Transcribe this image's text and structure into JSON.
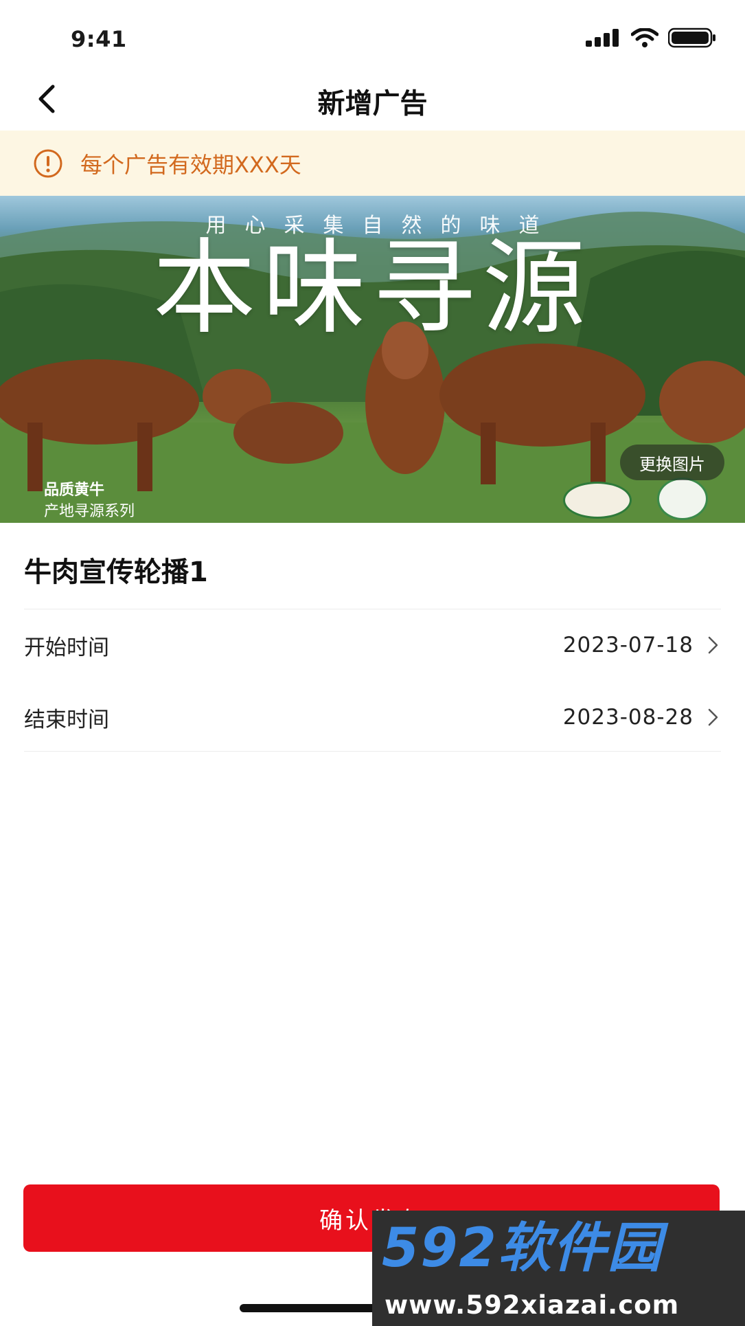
{
  "status_bar": {
    "time": "9:41"
  },
  "nav": {
    "title": "新增广告"
  },
  "notice": {
    "text": "每个广告有效期XXX天"
  },
  "banner": {
    "tagline": "用心采集自然的味道",
    "title": "本味寻源",
    "sub1": "品质黄牛",
    "sub2": "产地寻源系列",
    "change_label": "更换图片"
  },
  "form": {
    "ad_name": "牛肉宣传轮播1",
    "start": {
      "label": "开始时间",
      "value": "2023-07-18"
    },
    "end": {
      "label": "结束时间",
      "value": "2023-08-28"
    }
  },
  "confirm_label": "确认发布",
  "watermark": {
    "logo": "592软件园",
    "url": "www.592xiazai.com"
  },
  "colors": {
    "accent": "#e8101c",
    "notice_bg": "#fdf6e3",
    "notice_text": "#d2691e"
  },
  "icons": {
    "back": "chevron-left-icon",
    "notice": "exclamation-circle-icon",
    "row": "chevron-right-icon"
  }
}
